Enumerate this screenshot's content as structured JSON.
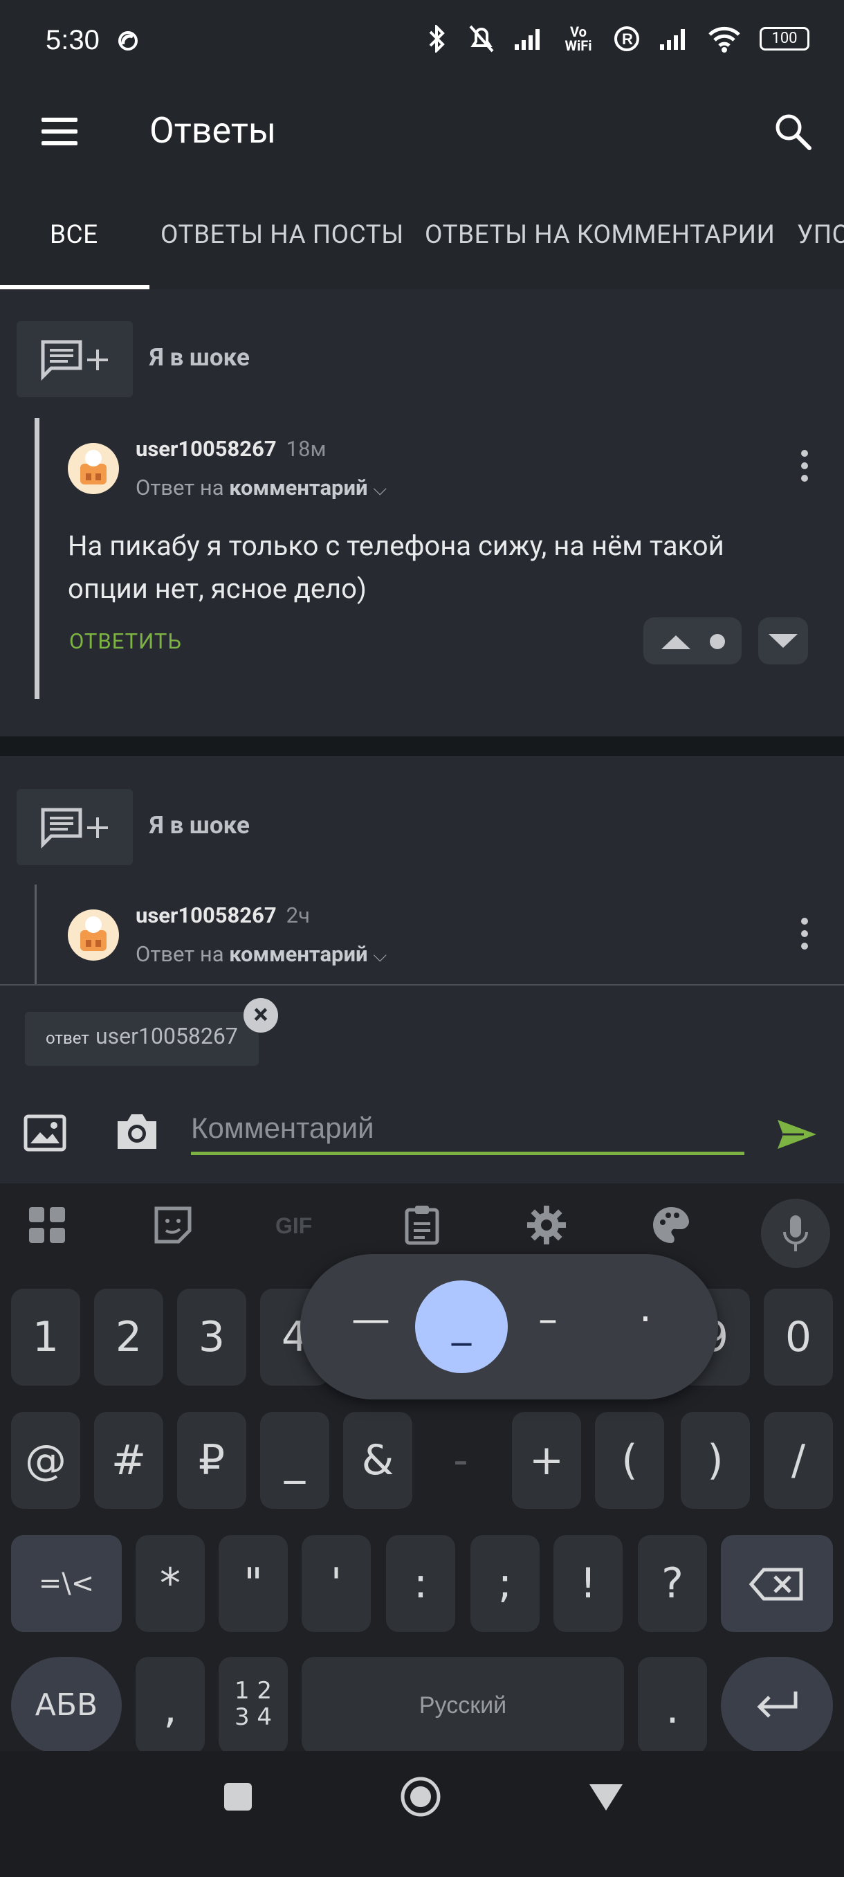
{
  "status_bar": {
    "time": "5:30",
    "battery": "100",
    "vowifi": "Vo WiFi"
  },
  "app_bar": {
    "title": "Ответы"
  },
  "tabs": [
    {
      "label": "ВСЕ",
      "active": true
    },
    {
      "label": "ОТВЕТЫ НА ПОСТЫ"
    },
    {
      "label": "ОТВЕТЫ НА КОММЕНТАРИИ"
    },
    {
      "label": "УПО"
    }
  ],
  "items": [
    {
      "post_title": "Я в шоке",
      "username": "user10058267",
      "time": "18м",
      "reply_prefix": "Ответ на",
      "reply_target": "комментарий",
      "text": "На пикабу я только с телефона сижу, на нём такой опции нет, ясное дело)",
      "reply_label": "ОТВЕТИТЬ"
    },
    {
      "post_title": "Я в шоке",
      "username": "user10058267",
      "time": "2ч",
      "reply_prefix": "Ответ на",
      "reply_target": "комментарий"
    }
  ],
  "composer": {
    "reply_chip_prefix": "ответ",
    "reply_chip_user": "user10058267",
    "placeholder": "Комментарий"
  },
  "keyboard": {
    "row1": [
      "1",
      "2",
      "3",
      "4",
      "",
      "",
      "",
      "",
      "9",
      "0"
    ],
    "row2": [
      "@",
      "#",
      "₽",
      "_",
      "&",
      "-",
      "+",
      "(",
      ")",
      "/"
    ],
    "row3": [
      "=\\<",
      "*",
      "\"",
      "'",
      ":",
      ";",
      "!",
      "?"
    ],
    "row4": {
      "abc": "АБВ",
      "comma": ",",
      "numpad_top": "1 2",
      "numpad_bottom": "3 4",
      "space": "Русский",
      "period": "."
    },
    "popup": [
      "—",
      "_",
      "–",
      "·"
    ]
  },
  "colors": {
    "accent": "#7cb342",
    "background": "#1d2126",
    "card": "#272b31",
    "popup_selected": "#aec6ff"
  }
}
